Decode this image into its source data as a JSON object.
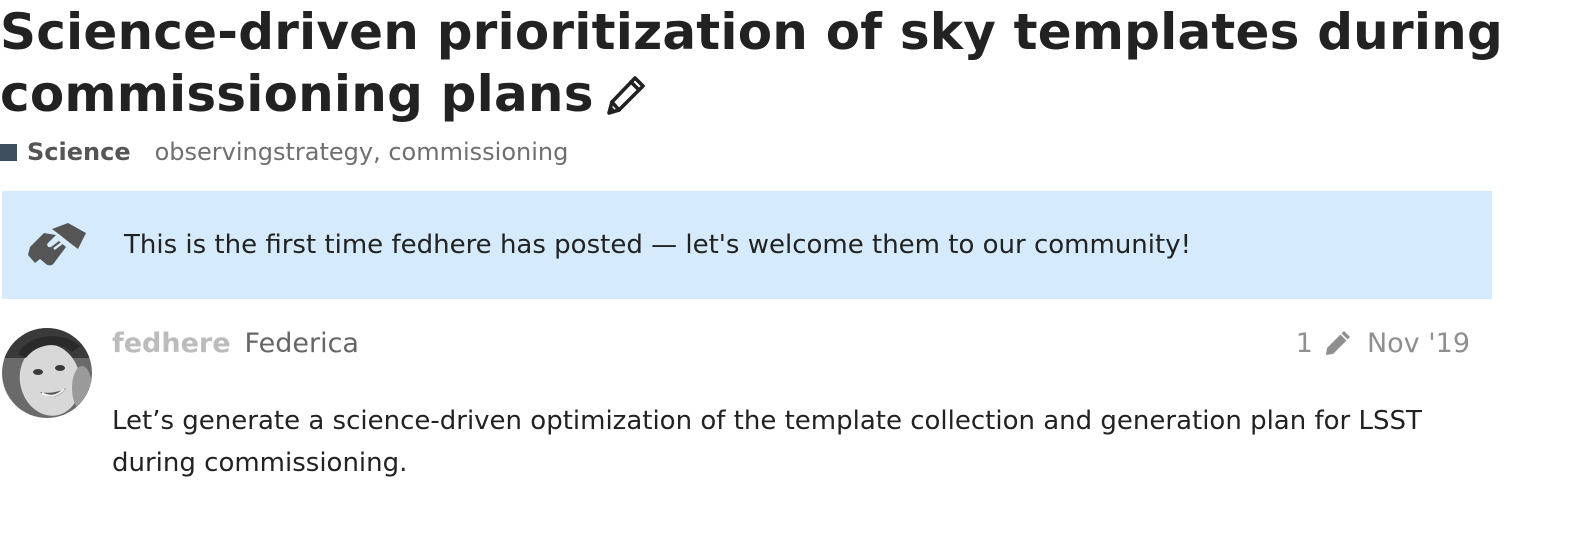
{
  "topic": {
    "title": "Science-driven prioritization of sky templates during commissioning plans",
    "category": {
      "name": "Science",
      "color": "#3d4e5f"
    },
    "tags": [
      "observingstrategy",
      "commissioning"
    ],
    "tags_text": "observingstrategy, commissioning",
    "icons": {
      "edit": "pencil-icon"
    }
  },
  "welcome_banner": {
    "icon": "handshake-icon",
    "text": "This is the first time fedhere has posted — let's welcome them to our community!",
    "background": "#d5ebfb"
  },
  "post": {
    "username": "fedhere",
    "full_name": "Federica",
    "edit_count": "1",
    "date": "Nov '19",
    "body": "Let’s generate a science-driven optimization of the template collection and generation plan for LSST during commissioning.",
    "avatar": "user-avatar"
  }
}
